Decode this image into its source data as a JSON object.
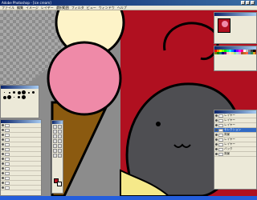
{
  "window": {
    "title": "Adobe Photoshop - [ice cream]"
  },
  "menu": [
    "ファイル",
    "編集",
    "イメージ",
    "レイヤー",
    "選択範囲",
    "フィルタ",
    "ビュー",
    "ウィンドウ",
    "ヘルプ"
  ],
  "layers_right": [
    {
      "name": "レイヤー",
      "selected": false
    },
    {
      "name": "レイヤー",
      "selected": false
    },
    {
      "name": "レイヤー",
      "selected": false
    },
    {
      "name": "セレクション",
      "selected": true
    },
    {
      "name": "背景",
      "selected": false
    },
    {
      "name": "レイヤー",
      "selected": false
    },
    {
      "name": "レイヤー",
      "selected": false
    },
    {
      "name": "バック",
      "selected": false
    },
    {
      "name": "背景",
      "selected": false
    }
  ],
  "colors": {
    "accent": "#0a246a",
    "red": "#b01020",
    "pink": "#ef8aa8",
    "cream": "#fdf3c8",
    "cone": "#8b5a10",
    "gray": "#4e4e52",
    "yellow": "#f5e98a"
  }
}
